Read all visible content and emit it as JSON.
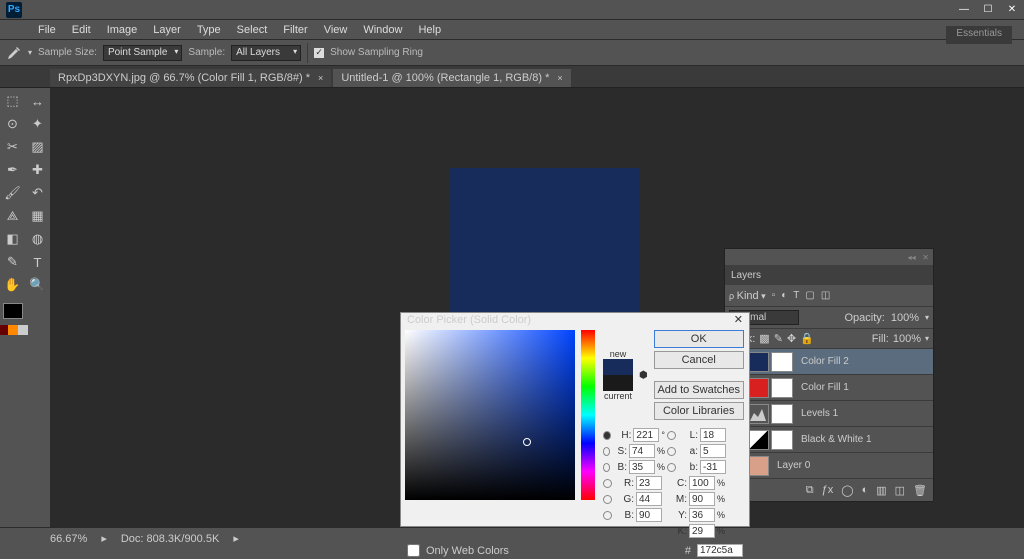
{
  "menu": {
    "items": [
      "File",
      "Edit",
      "Image",
      "Layer",
      "Type",
      "Select",
      "Filter",
      "View",
      "Window",
      "Help"
    ]
  },
  "options": {
    "sample_size_label": "Sample Size:",
    "sample_size_value": "Point Sample",
    "sample_label": "Sample:",
    "sample_value": "All Layers",
    "show_ring": "Show Sampling Ring"
  },
  "tabs": [
    {
      "label": "RpxDp3DXYN.jpg @ 66.7% (Color Fill 1, RGB/8#) *",
      "active": true
    },
    {
      "label": "Untitled-1 @ 100% (Rectangle 1, RGB/8) *",
      "active": false
    }
  ],
  "workspace_label": "Essentials",
  "layers": {
    "title": "Layers",
    "kind": "Kind",
    "mode": "Normal",
    "opacity_label": "Opacity:",
    "opacity_value": "100%",
    "lock_label": "Lock:",
    "fill_label": "Fill:",
    "fill_value": "100%",
    "items": [
      {
        "name": "Color Fill 2",
        "sel": true,
        "sw": "#172c5a",
        "mask": "#fff"
      },
      {
        "name": "Color Fill 1",
        "sel": false,
        "sw": "#d92020",
        "mask": "#fff"
      },
      {
        "name": "Levels 1",
        "sel": false,
        "sw": "#3a3a3a",
        "mask": "#fff",
        "icon": "levels"
      },
      {
        "name": "Black & White 1",
        "sel": false,
        "sw": "#3a3a3a",
        "mask": "#fff",
        "icon": "bw"
      },
      {
        "name": "Layer 0",
        "sel": false,
        "sw": "#d8a088",
        "mask": null
      }
    ]
  },
  "colorpicker": {
    "title": "Color Picker (Solid Color)",
    "new_label": "new",
    "current_label": "current",
    "ok": "OK",
    "cancel": "Cancel",
    "add": "Add to Swatches",
    "lib": "Color Libraries",
    "H": "221",
    "S": "74",
    "Bv": "35",
    "R": "23",
    "G": "44",
    "Bb": "90",
    "L": "18",
    "a": "5",
    "b": "-31",
    "C": "100",
    "M": "90",
    "Y": "36",
    "K": "29",
    "hex_label": "#",
    "hex": "172c5a",
    "only_web": "Only Web Colors"
  },
  "status": {
    "zoom": "66.67%",
    "doc": "Doc: 808.3K/900.5K"
  }
}
